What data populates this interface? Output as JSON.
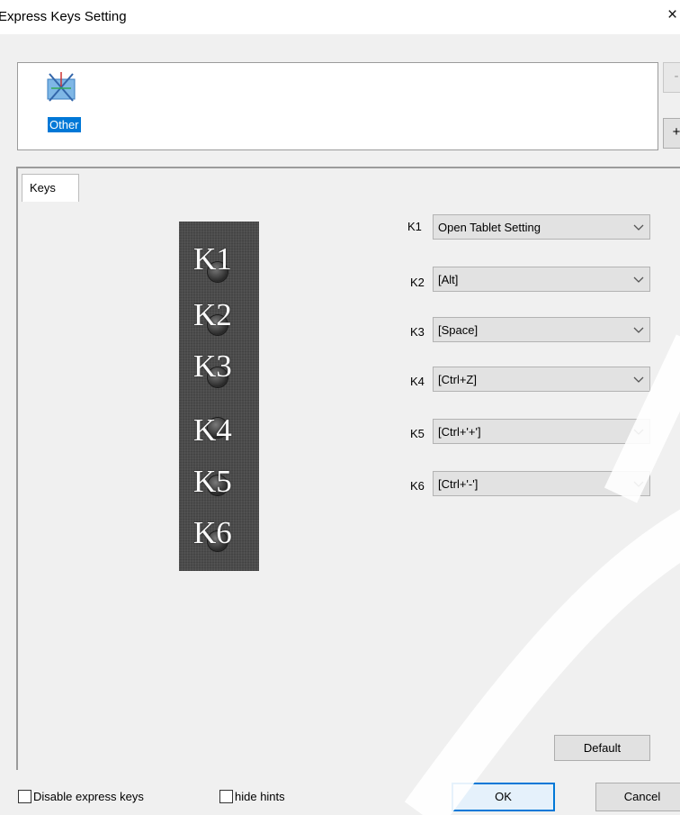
{
  "window": {
    "title": "Express Keys Setting",
    "close_glyph": "×"
  },
  "app_list": {
    "items": [
      {
        "label": "Other",
        "icon": "other-app-icon",
        "selected": true
      }
    ],
    "remove_label": "-",
    "add_label": "+"
  },
  "tabs": [
    {
      "label": "Keys"
    }
  ],
  "device": {
    "keys": [
      "K1",
      "K2",
      "K3",
      "K4",
      "K5",
      "K6"
    ]
  },
  "mappings": [
    {
      "key": "K1",
      "value": "Open Tablet Setting"
    },
    {
      "key": "K2",
      "value": "[Alt]"
    },
    {
      "key": "K3",
      "value": "[Space]"
    },
    {
      "key": "K4",
      "value": "[Ctrl+Z]"
    },
    {
      "key": "K5",
      "value": "[Ctrl+'+']"
    },
    {
      "key": "K6",
      "value": "[Ctrl+'-']"
    }
  ],
  "buttons": {
    "default": "Default",
    "ok": "OK",
    "cancel": "Cancel"
  },
  "options": {
    "disable_express_keys": "Disable express keys",
    "hide_hints": "hide hints"
  },
  "colors": {
    "accent": "#0078d7",
    "device": "#4b4b4b"
  }
}
